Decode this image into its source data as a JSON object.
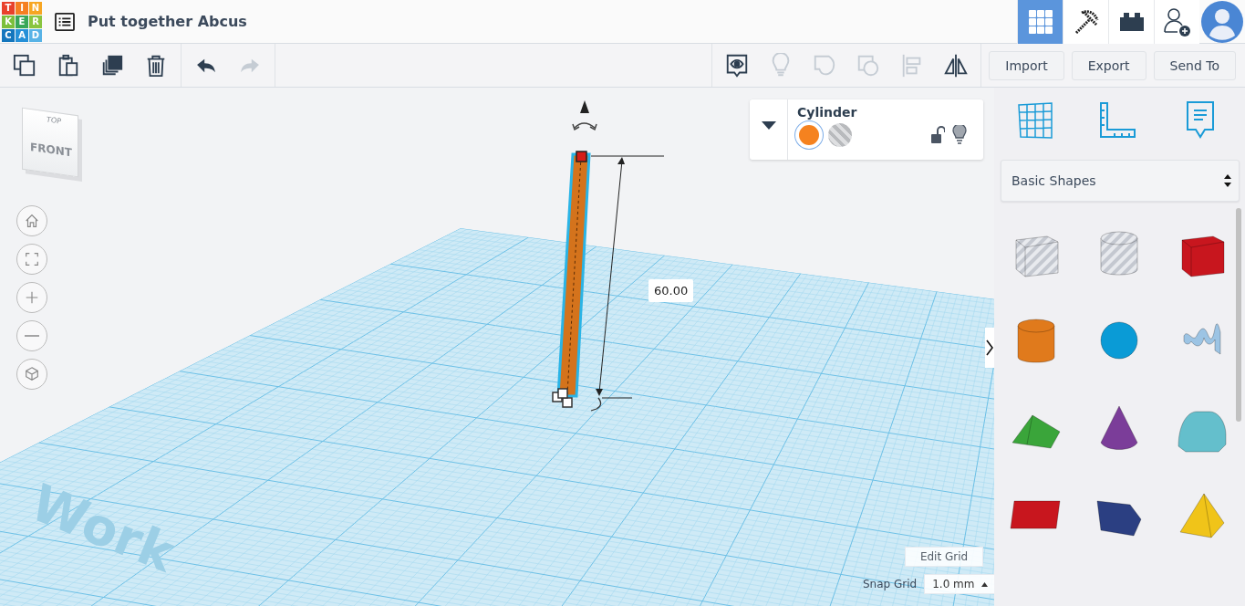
{
  "logo": {
    "letters": [
      {
        "text": "T",
        "color": "#e8412c"
      },
      {
        "text": "I",
        "color": "#f57f22"
      },
      {
        "text": "N",
        "color": "#f7a623"
      },
      {
        "text": "K",
        "color": "#7cbf3b"
      },
      {
        "text": "E",
        "color": "#3aa757"
      },
      {
        "text": "R",
        "color": "#89c540"
      },
      {
        "text": "C",
        "color": "#1476bd"
      },
      {
        "text": "A",
        "color": "#2590d8"
      },
      {
        "text": "D",
        "color": "#58b3e6"
      }
    ]
  },
  "title": "Put together Abcus",
  "header_tabs": [
    {
      "kind": "grid",
      "selected": true
    },
    {
      "kind": "pickaxe",
      "selected": false
    },
    {
      "kind": "brick",
      "selected": false
    },
    {
      "kind": "add-user",
      "selected": false
    }
  ],
  "edit_tools": [
    {
      "kind": "copy",
      "disabled": false
    },
    {
      "kind": "paste",
      "disabled": false
    },
    {
      "kind": "duplicate",
      "disabled": false
    },
    {
      "kind": "delete",
      "disabled": false
    },
    {
      "kind": "undo",
      "disabled": false
    },
    {
      "kind": "redo",
      "disabled": true
    }
  ],
  "view_tools": [
    {
      "kind": "notes",
      "disabled": false
    },
    {
      "kind": "light",
      "disabled": true
    },
    {
      "kind": "group",
      "disabled": true
    },
    {
      "kind": "ungroup",
      "disabled": true
    },
    {
      "kind": "align",
      "disabled": true
    },
    {
      "kind": "mirror",
      "disabled": false
    }
  ],
  "actions": [
    "Import",
    "Export",
    "Send To"
  ],
  "view_cube": {
    "top": "TOP",
    "front": "FRONT"
  },
  "nav_controls": [
    {
      "kind": "home"
    },
    {
      "kind": "fit"
    },
    {
      "kind": "zoom-in"
    },
    {
      "kind": "zoom-out"
    },
    {
      "kind": "ortho"
    }
  ],
  "shape_panel": {
    "name": "Cylinder",
    "modes": [
      {
        "kind": "solid",
        "selected": true,
        "color": "#f5821f"
      },
      {
        "kind": "hole",
        "selected": false
      }
    ],
    "locked": false
  },
  "dimension": "60.00",
  "workplane_label": "Work",
  "edit_grid": "Edit Grid",
  "snap_grid": {
    "label": "Snap Grid",
    "value": "1.0 mm"
  },
  "library": {
    "tools": [
      {
        "kind": "workplane"
      },
      {
        "kind": "ruler"
      },
      {
        "kind": "notes"
      }
    ],
    "category": "Basic Shapes",
    "shapes": [
      {
        "kind": "box",
        "hole": true,
        "color": "#c4c8d0"
      },
      {
        "kind": "cylinder",
        "hole": true,
        "color": "#c4c8d0"
      },
      {
        "kind": "box",
        "hole": false,
        "color": "#c8161e"
      },
      {
        "kind": "cylinder",
        "hole": false,
        "color": "#e07a1c"
      },
      {
        "kind": "sphere",
        "hole": false,
        "color": "#0a9bd6"
      },
      {
        "kind": "scribble",
        "hole": false,
        "color": "#9cc4e4"
      },
      {
        "kind": "roof",
        "hole": false,
        "color": "#3aa53a"
      },
      {
        "kind": "cone",
        "hole": false,
        "color": "#7b3d99"
      },
      {
        "kind": "round-roof",
        "hole": false,
        "color": "#64bfcc"
      },
      {
        "kind": "text",
        "hole": false,
        "color": "#c8161e"
      },
      {
        "kind": "wedge",
        "hole": false,
        "color": "#2b3f82"
      },
      {
        "kind": "pyramid",
        "hole": false,
        "color": "#f0c419"
      }
    ]
  }
}
